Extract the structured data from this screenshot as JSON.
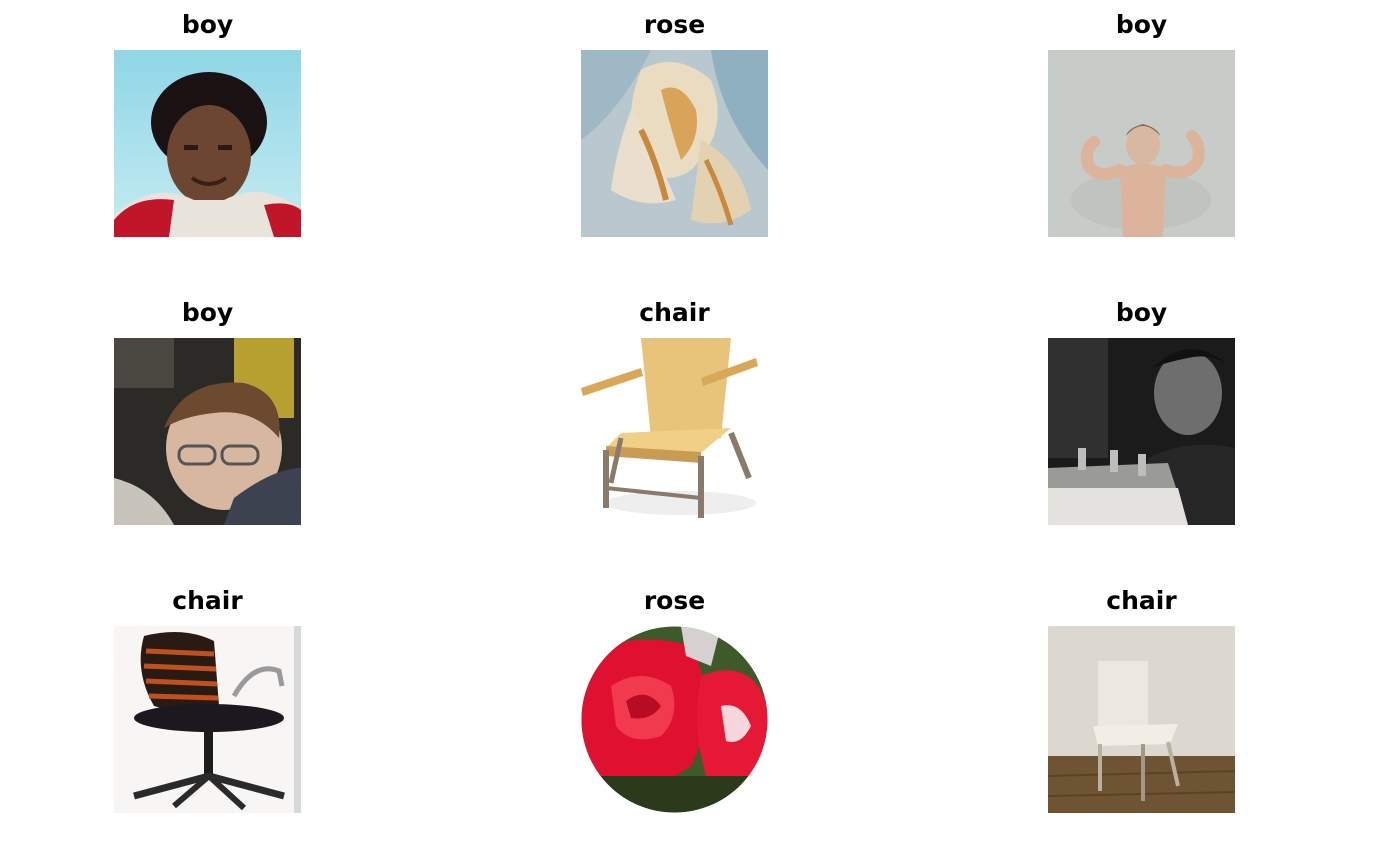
{
  "grid": {
    "images": [
      {
        "label": "boy",
        "icon": "portrait-boy-red-shirt-photo"
      },
      {
        "label": "rose",
        "icon": "cream-rose-closeup-photo"
      },
      {
        "label": "boy",
        "icon": "boy-flexing-arms-photo"
      },
      {
        "label": "boy",
        "icon": "boy-with-glasses-photo"
      },
      {
        "label": "chair",
        "icon": "wooden-armchair-photo"
      },
      {
        "label": "boy",
        "icon": "boy-black-and-white-photo"
      },
      {
        "label": "chair",
        "icon": "office-chair-photo"
      },
      {
        "label": "rose",
        "icon": "red-roses-circle-photo"
      },
      {
        "label": "chair",
        "icon": "white-chair-room-photo"
      }
    ]
  }
}
